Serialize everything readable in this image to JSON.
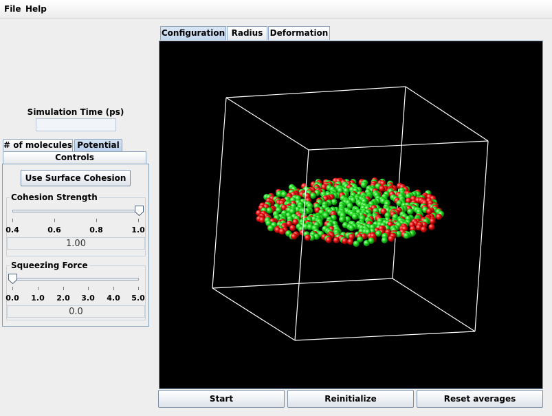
{
  "menu": {
    "file": "File",
    "help": "Help"
  },
  "simulation": {
    "time_label": "Simulation Time (ps)",
    "time_value": ""
  },
  "left_tabs": {
    "molecules": "# of molecules",
    "potential": "Potential",
    "controls": "Controls"
  },
  "controls": {
    "surface_cohesion_button": "Use Surface Cohesion",
    "cohesion": {
      "title": "Cohesion Strength",
      "ticks": [
        "0.4",
        "0.6",
        "0.8",
        "1.0"
      ],
      "value": "1.00",
      "fraction": 1.0
    },
    "squeezing": {
      "title": "Squeezing Force",
      "ticks": [
        "0.0",
        "1.0",
        "2.0",
        "3.0",
        "4.0",
        "5.0"
      ],
      "value": "0.0",
      "fraction": 0.0
    }
  },
  "view_tabs": {
    "configuration": "Configuration",
    "radius": "Radius",
    "deformation": "Deformation"
  },
  "buttons": {
    "start": "Start",
    "reinitialize": "Reinitialize",
    "reset": "Reset averages"
  },
  "colors": {
    "molecule_a": "#22dd22",
    "molecule_b": "#ee1111",
    "box_lines": "#ffffff",
    "viewer_bg": "#000000"
  }
}
